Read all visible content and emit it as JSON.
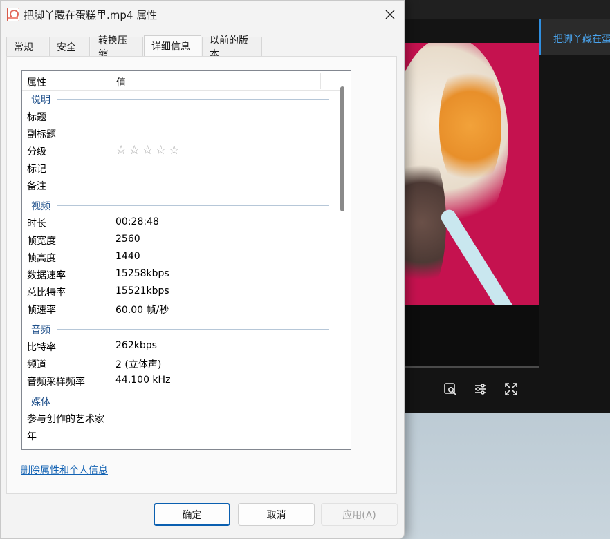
{
  "dialog": {
    "title": "把脚丫藏在蛋糕里.mp4 属性",
    "tabs": [
      {
        "label": "常规"
      },
      {
        "label": "安全"
      },
      {
        "label": "转换压缩"
      },
      {
        "label": "详细信息",
        "active": true
      },
      {
        "label": "以前的版本"
      }
    ],
    "columns": {
      "property": "属性",
      "value": "值"
    },
    "groups": {
      "description": {
        "title": "说明",
        "rows": [
          {
            "key": "标题",
            "value": ""
          },
          {
            "key": "副标题",
            "value": ""
          },
          {
            "key": "分级",
            "value": "",
            "stars": 0
          },
          {
            "key": "标记",
            "value": ""
          },
          {
            "key": "备注",
            "value": ""
          }
        ]
      },
      "video": {
        "title": "视频",
        "rows": [
          {
            "key": "时长",
            "value": "00:28:48"
          },
          {
            "key": "帧宽度",
            "value": "2560"
          },
          {
            "key": "帧高度",
            "value": "1440"
          },
          {
            "key": "数据速率",
            "value": "15258kbps"
          },
          {
            "key": "总比特率",
            "value": "15521kbps"
          },
          {
            "key": "帧速率",
            "value": "60.00 帧/秒"
          }
        ]
      },
      "audio": {
        "title": "音频",
        "rows": [
          {
            "key": "比特率",
            "value": "262kbps"
          },
          {
            "key": "频道",
            "value": "2 (立体声)"
          },
          {
            "key": "音频采样频率",
            "value": "44.100 kHz"
          }
        ]
      },
      "media": {
        "title": "媒体",
        "rows": [
          {
            "key": "参与创作的艺术家",
            "value": ""
          },
          {
            "key": "年",
            "value": ""
          }
        ]
      }
    },
    "remove_link": "删除属性和个人信息",
    "buttons": {
      "ok": "确定",
      "cancel": "取消",
      "apply": "应用(A)"
    }
  },
  "player": {
    "side_panel_title": "把脚丫藏在蛋",
    "controls": [
      "image-search-icon",
      "settings-sliders-icon",
      "fullscreen-icon"
    ],
    "accent": "#2f8fe0",
    "video_bg": "#c5124f"
  }
}
